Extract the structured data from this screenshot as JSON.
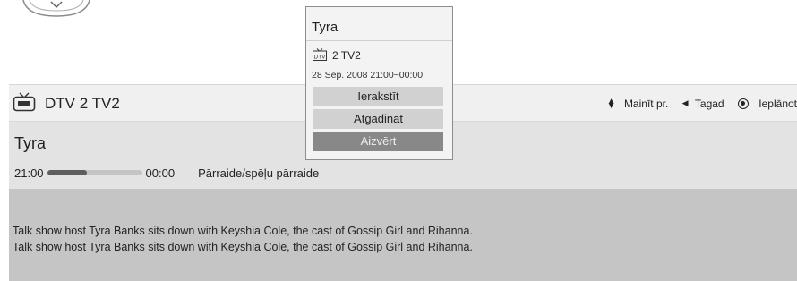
{
  "header": {
    "channel_label": "DTV 2  TV2",
    "icons": {
      "channel": "tv-icon",
      "updown": "up-down-arrows-icon",
      "left": "left-arrow-icon",
      "record": "record-icon"
    },
    "legend": {
      "change_label": "Mainīt pr.",
      "back_label": "Tagad",
      "schedule_label": "Ieplānot"
    }
  },
  "program": {
    "title": "Tyra",
    "start_time": "21:00",
    "end_time": "00:00",
    "progress": 0.42,
    "genre": "Pārraide/spēļu pārraide",
    "description_lines": [
      "Talk show host Tyra Banks sits down with Keyshia Cole, the cast of Gossip Girl and Rihanna.",
      "Talk show host Tyra Banks sits down with Keyshia Cole, the cast of Gossip Girl and Rihanna."
    ]
  },
  "popup": {
    "title": "Tyra",
    "channel": "2 TV2",
    "datetime": "28 Sep. 2008 21:00~00:00",
    "buttons": {
      "record": "Ierakstīt",
      "remind": "Atgādināt",
      "close": "Aizvērt"
    }
  },
  "colors": {
    "panel_bg": "#e3e3e3",
    "description_bg": "#c5c5c5",
    "button_bg": "#d1d1d1",
    "button_selected_bg": "#888888"
  }
}
